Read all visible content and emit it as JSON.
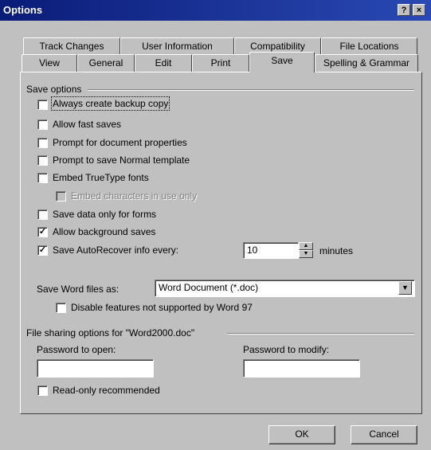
{
  "window": {
    "title": "Options",
    "help_button": "?",
    "close_button": "×"
  },
  "tabs": {
    "row_back": [
      {
        "label": "Track Changes"
      },
      {
        "label": "User Information"
      },
      {
        "label": "Compatibility"
      },
      {
        "label": "File Locations"
      }
    ],
    "row_front": [
      {
        "label": "View"
      },
      {
        "label": "General"
      },
      {
        "label": "Edit"
      },
      {
        "label": "Print"
      },
      {
        "label": "Save",
        "active": true
      },
      {
        "label": "Spelling & Grammar"
      }
    ]
  },
  "save_options": {
    "heading": "Save options",
    "items": [
      {
        "label": "Always create backup copy",
        "checked": false,
        "enabled": true
      },
      {
        "label": "Allow fast saves",
        "checked": false,
        "enabled": true
      },
      {
        "label": "Prompt for document properties",
        "checked": false,
        "enabled": true
      },
      {
        "label": "Prompt to save Normal template",
        "checked": false,
        "enabled": true
      },
      {
        "label": "Embed TrueType fonts",
        "checked": false,
        "enabled": true
      },
      {
        "label": "Embed characters in use only",
        "checked": false,
        "enabled": false
      },
      {
        "label": "Save data only for forms",
        "checked": false,
        "enabled": true
      },
      {
        "label": "Allow background saves",
        "checked": true,
        "enabled": true
      },
      {
        "label": "Save AutoRecover info every:",
        "checked": true,
        "enabled": true
      }
    ],
    "autorecover_value": "10",
    "autorecover_unit": "minutes",
    "save_word_files_label": "Save Word files as:",
    "save_word_files_value": "Word Document (*.doc)",
    "disable_features_label": "Disable features not supported by Word 97",
    "disable_features_checked": false
  },
  "file_sharing": {
    "heading": "File sharing options for \"Word2000.doc\"",
    "password_open_label": "Password to open:",
    "password_open_value": "",
    "password_modify_label": "Password to modify:",
    "password_modify_value": "",
    "readonly_label": "Read-only recommended",
    "readonly_checked": false
  },
  "buttons": {
    "ok": "OK",
    "cancel": "Cancel"
  },
  "check_mark": "✓",
  "spin_up": "▲",
  "spin_down": "▼",
  "dropdown_arrow": "▼"
}
